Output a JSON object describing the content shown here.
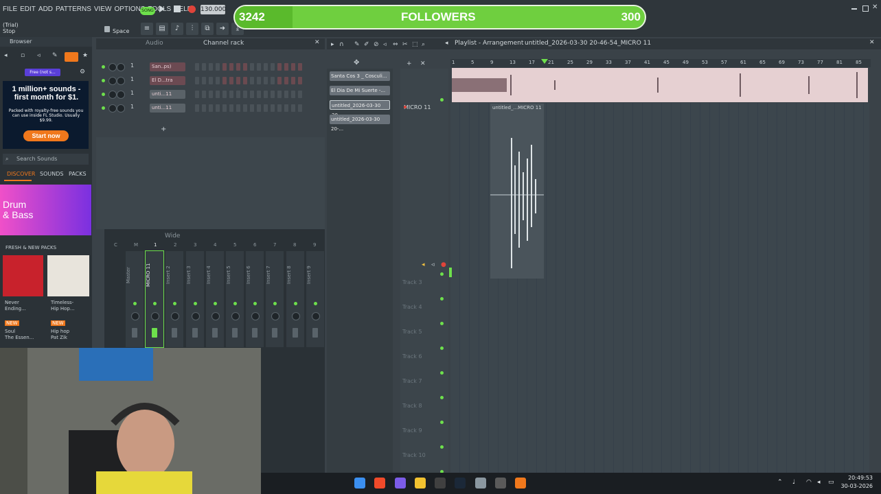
{
  "menu": [
    "FILE",
    "EDIT",
    "ADD",
    "PATTERNS",
    "VIEW",
    "OPTIONS",
    "TOOLS",
    "HELP"
  ],
  "transport": {
    "song_label": "SONG",
    "tempo": "130.000"
  },
  "hint": {
    "line1": "(Trial)",
    "line2": "Stop",
    "key": "Space"
  },
  "followers": {
    "current": "3242",
    "label": "FOLLOWERS",
    "goal": "300"
  },
  "browser": {
    "title": "Browser",
    "ad": {
      "headline": "1 million+ sounds - first month for $1.",
      "body": "Packed with royalty-free sounds you can use inside FL Studio. Usually $9.99.",
      "cta": "Start now"
    },
    "promo_badge": "Free (not s...",
    "search_placeholder": "Search Sounds",
    "tabs": [
      "DISCOVER",
      "SOUNDS",
      "PACKS"
    ],
    "banner": {
      "line1": "Drum",
      "line2": "& Bass"
    },
    "fresh_label": "FRESH & NEW PACKS",
    "packs": [
      {
        "title1": "Never",
        "title2": "Ending...",
        "badge": "NEW",
        "genre": "Soul",
        "author": "The Essen..."
      },
      {
        "title1": "Timeless-",
        "title2": "Hip Hop...",
        "badge": "NEW",
        "genre": "Hip hop",
        "author": "Pat Zik"
      }
    ]
  },
  "channel_rack": {
    "tab_audio": "Audio",
    "title": "Channel rack",
    "channels": [
      {
        "num": "1",
        "name": "San..ps)"
      },
      {
        "num": "1",
        "name": "El D...tra"
      },
      {
        "num": "1",
        "name": "unti...11"
      },
      {
        "num": "1",
        "name": "unti...11"
      }
    ]
  },
  "mixer": {
    "preset": "Wide",
    "columns": [
      "C",
      "M",
      "1",
      "2",
      "3",
      "4",
      "5",
      "6",
      "7",
      "8",
      "9"
    ],
    "strips": [
      "Master",
      "MICRO 11",
      "Insert 2",
      "Insert 3",
      "Insert 4",
      "Insert 5",
      "Insert 6",
      "Insert 7",
      "Insert 8",
      "Insert 9"
    ]
  },
  "playlist": {
    "title": "Playlist - Arrangement",
    "breadcrumb": "untitled_2026-03-30 20-46-54_MICRO 11",
    "picker": [
      "Santa Cos 3 _ Cosculi...",
      "El Dia De Mi Suerte -...",
      "untitled_2026-03-30 20-...",
      "untitled_2026-03-30 20-..."
    ],
    "ruler": [
      "1",
      "5",
      "9",
      "13",
      "17",
      "21",
      "25",
      "29",
      "33",
      "37",
      "41",
      "45",
      "49",
      "53",
      "57",
      "61",
      "65",
      "69",
      "73",
      "77",
      "81",
      "85"
    ],
    "track1": "MICRO 11",
    "clip2": "untitled_...MICRO 11",
    "tracks": [
      "Track 3",
      "Track 4",
      "Track 5",
      "Track 6",
      "Track 7",
      "Track 8",
      "Track 9",
      "Track 10"
    ]
  },
  "taskbar": {
    "time": "20:49:53",
    "date": "30-03-2026"
  },
  "colors": {
    "accent_green": "#6ee04c",
    "followers_bar": "#6fcf3f",
    "cta_orange": "#f0781c"
  }
}
